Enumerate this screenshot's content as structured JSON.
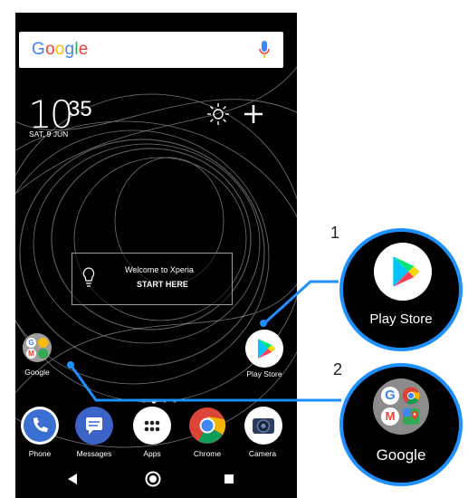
{
  "search": {
    "logo": "Google"
  },
  "clock": {
    "hour": "10",
    "minute": "35",
    "date": "SAT, 9 JUN"
  },
  "welcome": {
    "line1": "Welcome to Xperia",
    "line2": "START HERE"
  },
  "apps": {
    "google_folder": "Google",
    "play_store": "Play Store"
  },
  "dock": [
    {
      "label": "Phone"
    },
    {
      "label": "Messages"
    },
    {
      "label": "Apps"
    },
    {
      "label": "Chrome"
    },
    {
      "label": "Camera"
    }
  ],
  "callouts": [
    {
      "number": "1",
      "label": "Play Store"
    },
    {
      "number": "2",
      "label": "Google"
    }
  ],
  "colors": {
    "callout_line": "#1e90ff",
    "background": "#000000"
  },
  "icons": [
    "mic-icon",
    "brightness-icon",
    "plus-icon",
    "lightbulb-icon",
    "back-icon",
    "home-icon",
    "recents-icon"
  ]
}
